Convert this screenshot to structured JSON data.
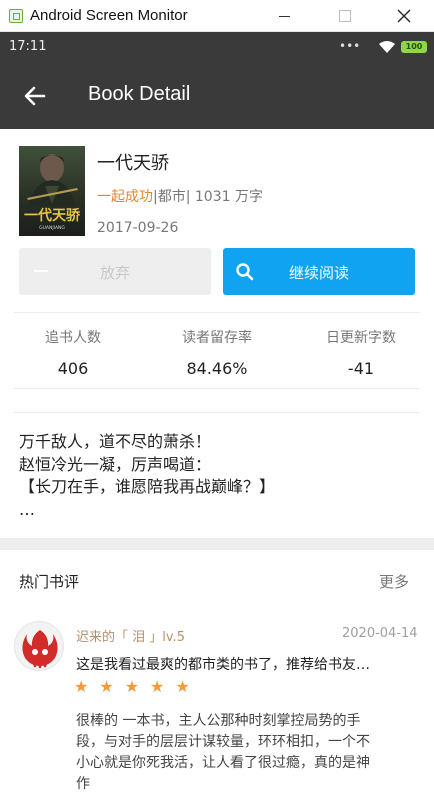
{
  "window": {
    "title": "Android Screen Monitor"
  },
  "status_bar": {
    "time": "17:11",
    "dots": "•••",
    "battery": "100"
  },
  "toolbar": {
    "title": "Book Detail"
  },
  "book": {
    "title": "一代天骄",
    "author": "一起成功",
    "meta_rest": "|都市| 1031 万字",
    "date": "2017-09-26",
    "cover": {
      "title_text": "一代天骄",
      "small_text": "GUANJIANG"
    }
  },
  "actions": {
    "abandon_label": "放弃",
    "continue_label": "继续阅读"
  },
  "stats": [
    {
      "label": "追书人数",
      "value": "406"
    },
    {
      "label": "读者留存率",
      "value": "84.46%"
    },
    {
      "label": "日更新字数",
      "value": "-41"
    }
  ],
  "intro": {
    "lines": [
      "万千敌人，道不尽的萧杀！",
      "赵恒冷光一凝，厉声喝道：",
      "【长刀在手，谁愿陪我再战巅峰？】",
      "…"
    ]
  },
  "hot_reviews": {
    "title": "热门书评",
    "more": "更多",
    "items": [
      {
        "reviewer": "迟来的「 泪 」lv.5",
        "date": "2020-04-14",
        "title": "这是我看过最爽的都市类的书了，推荐给书友…",
        "rating": 5,
        "stars": "★★★★★",
        "body_lines": [
          "很棒的 一本书，主人公那种时刻掌控局势的手",
          "段，与对手的层层计谋较量，环环相扣，一个不",
          "小心就是你死我活，让人看了很过瘾，真的是神",
          "作"
        ]
      }
    ]
  },
  "colors": {
    "toolbar": "#3a3a3a",
    "accent_blue": "#10a3f2",
    "author_orange": "#e8852b",
    "star_orange": "#f29a3c",
    "reviewer_brown": "#b7906a"
  }
}
